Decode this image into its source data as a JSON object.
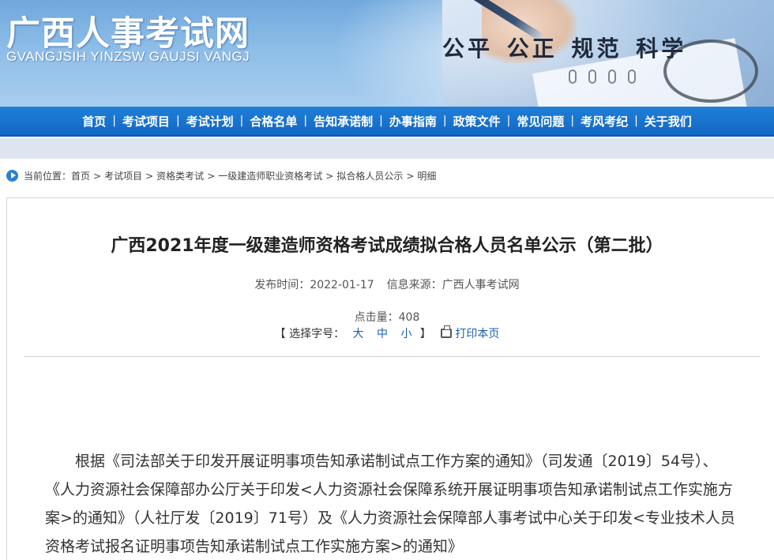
{
  "header": {
    "site_title": "广西人事考试网",
    "site_pinyin": "GVANGJSIH YINZSW GAUJSI VANGJ",
    "slogan": "公平 公正 规范 科学"
  },
  "nav": {
    "items": [
      "首页",
      "考试项目",
      "考试计划",
      "合格名单",
      "告知承诺制",
      "办事指南",
      "政策文件",
      "常见问题",
      "考风考纪",
      "关于我们"
    ],
    "separator": "|"
  },
  "breadcrumb": {
    "prefix": "当前位置：",
    "items": [
      "首页",
      "考试项目",
      "资格类考试",
      "一级建造师职业资格考试",
      "拟合格人员公示",
      "明细"
    ],
    "separator": ">"
  },
  "article": {
    "title": "广西2021年度一级建造师资格考试成绩拟合格人员名单公示（第二批）",
    "publish_label": "发布时间：",
    "publish_date": "2022-01-17",
    "source_label": "信息来源：",
    "source": "广西人事考试网",
    "hits_label": "点击量：",
    "hits": "408",
    "font_open": "【 选择字号：",
    "font_large": "大",
    "font_medium": "中",
    "font_small": "小",
    "font_close": "】",
    "print_label": "打印本页",
    "body": "根据《司法部关于印发开展证明事项告知承诺制试点工作方案的通知》（司发通〔2019〕54号）、《人力资源社会保障部办公厅关于印发<人力资源社会保障系统开展证明事项告知承诺制试点工作实施方案>的通知》（人社厅发〔2019〕71号）及《人力资源社会保障部人事考试中心关于印发<专业技术人员资格考试报名证明事项告知承诺制试点工作实施方案>的通知》"
  },
  "colors": {
    "nav_bg": "#1468c3",
    "link": "#1a5fb4",
    "title_text": "#222222"
  },
  "icons": {
    "location": "location-arrow-icon",
    "print": "printer-icon"
  }
}
